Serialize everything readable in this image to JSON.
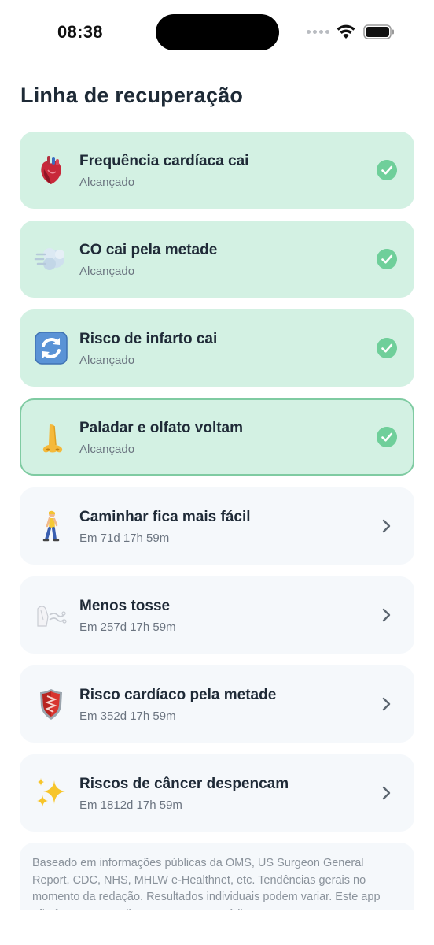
{
  "status_bar": {
    "time": "08:38"
  },
  "page": {
    "title": "Linha de recuperação"
  },
  "milestones": [
    {
      "title": "Frequência cardíaca cai",
      "subtitle": "Alcançado",
      "state": "done",
      "icon": "anatomical-heart-icon"
    },
    {
      "title": "CO cai pela metade",
      "subtitle": "Alcançado",
      "state": "done",
      "icon": "dashing-away-icon"
    },
    {
      "title": "Risco de infarto cai",
      "subtitle": "Alcançado",
      "state": "done",
      "icon": "counterclockwise-arrows-icon"
    },
    {
      "title": "Paladar e olfato voltam",
      "subtitle": "Alcançado",
      "state": "current",
      "icon": "nose-icon"
    },
    {
      "title": "Caminhar fica mais fácil",
      "subtitle": "Em 71d 17h 59m",
      "state": "pending",
      "icon": "person-walking-icon"
    },
    {
      "title": "Menos tosse",
      "subtitle": "Em 257d 17h 59m",
      "state": "pending",
      "icon": "lungs-wind-icon"
    },
    {
      "title": "Risco cardíaco pela metade",
      "subtitle": "Em 352d 17h 59m",
      "state": "pending",
      "icon": "shield-icon"
    },
    {
      "title": "Riscos de câncer despencam",
      "subtitle": "Em 1812d 17h 59m",
      "state": "pending",
      "icon": "sparkles-icon"
    }
  ],
  "footer": {
    "disclaimer": "Baseado em informações públicas da OMS, US Surgeon General Report, CDC, NHS, MHLW e-Healthnet, etc. Tendências gerais no momento da redação. Resultados individuais podem variar. Este app não fornece conselho ou tratamento médico."
  },
  "colors": {
    "done_bg": "#d3f1e3",
    "current_border": "#7fcba2",
    "pending_bg": "#f5f8fb",
    "check_green": "#6fcf9a",
    "title_text": "#1f2a37",
    "subtitle_text": "#6b7480"
  }
}
